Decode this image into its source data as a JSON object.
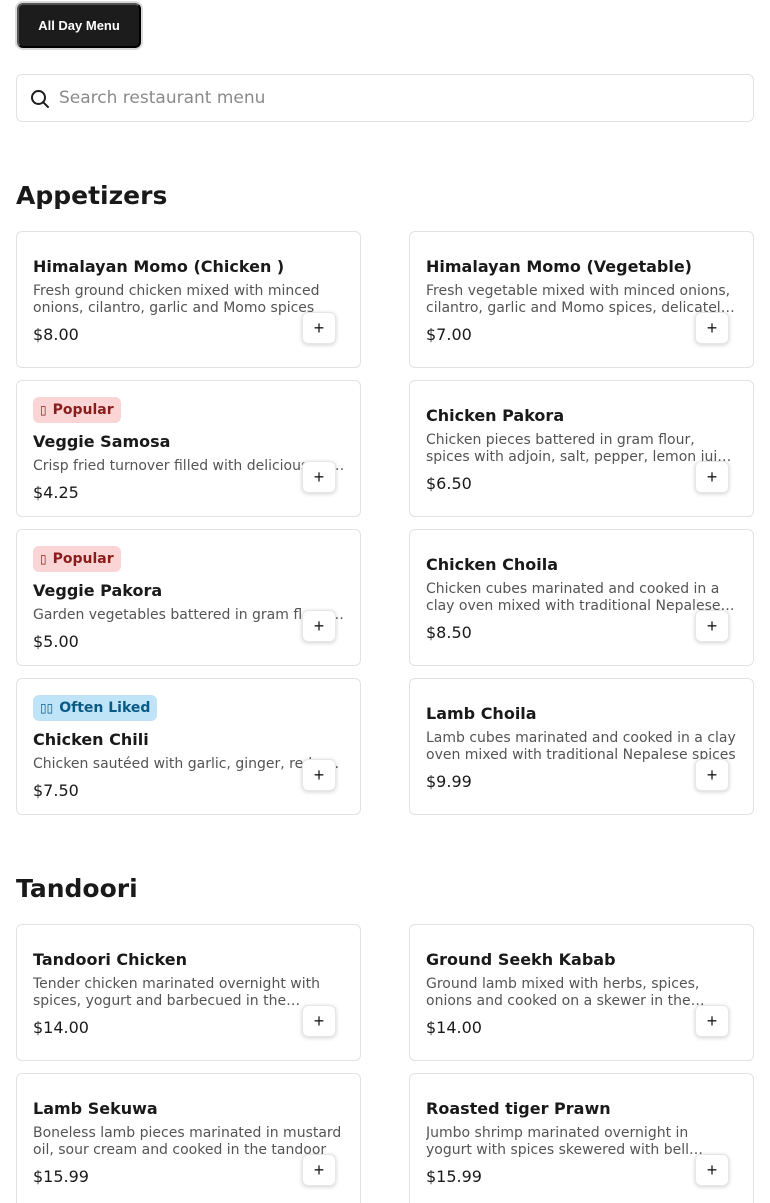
{
  "menu_tab": {
    "label": "All Day Menu"
  },
  "search": {
    "placeholder": "Search restaurant menu",
    "icon": "search-icon"
  },
  "sections": [
    {
      "title": "Appetizers",
      "items": [
        {
          "name": "Himalayan Momo (Chicken )",
          "description": "Fresh ground chicken mixed with minced onions, cilantro, garlic and Momo spices",
          "price": "$8.00",
          "badge": ""
        },
        {
          "name": "Himalayan Momo (Vegetable)",
          "description": "Fresh vegetable mixed with minced onions, cilantro, garlic and Momo spices, delicately wrapped",
          "price": "$7.00",
          "badge": ""
        },
        {
          "name": "Veggie Samosa",
          "description": "Crisp fried turnover filled with delicious potatoes and green peas",
          "price": "$4.25",
          "badge": "Popular"
        },
        {
          "name": "Chicken Pakora",
          "description": "Chicken pieces battered in gram flour, spices with adjoin, salt, pepper, lemon juice and fried",
          "price": "$6.50",
          "badge": ""
        },
        {
          "name": "Veggie Pakora",
          "description": "Garden vegetables battered in gram flour and spices",
          "price": "$5.00",
          "badge": "Popular"
        },
        {
          "name": "Chicken Choila",
          "description": "Chicken cubes marinated and cooked in a clay oven mixed with traditional Nepalese spices",
          "price": "$8.50",
          "badge": ""
        },
        {
          "name": "Chicken Chili",
          "description": "Chicken sautéed with garlic, ginger, red onions and bell peppers",
          "price": "$7.50",
          "badge": "Often Liked"
        },
        {
          "name": "Lamb Choila",
          "description": "Lamb cubes marinated and cooked in a clay oven mixed with traditional Nepalese spices",
          "price": "$9.99",
          "badge": ""
        }
      ]
    },
    {
      "title": "Tandoori",
      "items": [
        {
          "name": "Tandoori Chicken",
          "description": "Tender chicken marinated overnight with spices, yogurt and barbecued in the tandoor",
          "price": "$14.00",
          "badge": ""
        },
        {
          "name": "Ground Seekh Kabab",
          "description": "Ground lamb mixed with herbs, spices, onions and cooked on a skewer in the tandoor",
          "price": "$14.00",
          "badge": ""
        },
        {
          "name": "Lamb Sekuwa",
          "description": "Boneless lamb pieces marinated in mustard oil, sour cream and cooked in the tandoor",
          "price": "$15.99",
          "badge": ""
        },
        {
          "name": "Roasted tiger Prawn",
          "description": "Jumbo shrimp marinated overnight in yogurt with spices skewered with bell peppers",
          "price": "$15.99",
          "badge": ""
        }
      ]
    }
  ],
  "add_button_label": "+",
  "badge_icons": {
    "Popular": "fire-icon",
    "Often Liked": "thumbs-up-icon"
  },
  "colors": {
    "popular_bg": "#fbd5d5",
    "popular_text": "#8a1c1c",
    "liked_bg": "#bfe3f7",
    "liked_text": "#0a5a86",
    "tab_bg": "#1c1c1c"
  }
}
